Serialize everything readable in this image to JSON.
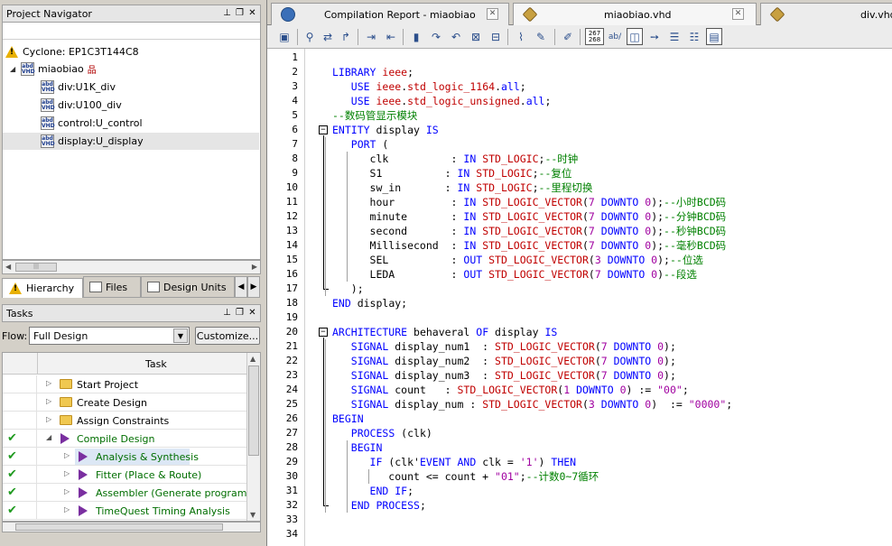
{
  "project_navigator": {
    "title": "Project Navigator",
    "device": "Cyclone: EP1C3T144C8",
    "top_entity": "miaobiao",
    "entities": [
      "div:U1K_div",
      "div:U100_div",
      "control:U_control",
      "display:U_display"
    ],
    "tabs": [
      "Hierarchy",
      "Files",
      "Design Units"
    ]
  },
  "tasks": {
    "title": "Tasks",
    "flow_label": "Flow:",
    "flow_value": "Full Design",
    "customize_label": "Customize...",
    "column_task": "Task",
    "rows": [
      {
        "label": "Start Project",
        "done": false
      },
      {
        "label": "Create Design",
        "done": false
      },
      {
        "label": "Assign Constraints",
        "done": false
      },
      {
        "label": "Compile Design",
        "done": true
      },
      {
        "label": "Analysis & Synthesis",
        "done": true
      },
      {
        "label": "Fitter (Place & Route)",
        "done": true
      },
      {
        "label": "Assembler (Generate programming",
        "done": true
      },
      {
        "label": "TimeQuest Timing Analysis",
        "done": true
      }
    ]
  },
  "editor": {
    "tabs": [
      {
        "label": "Compilation Report - miaobiao",
        "icon": "report-icon"
      },
      {
        "label": "miaobiao.vhd",
        "icon": "vhd-file-icon"
      },
      {
        "label": "div.vhd",
        "icon": "vhd-file-icon"
      }
    ],
    "toolbar": {
      "line_counter_top": "267",
      "line_counter_bottom": "268",
      "abc_label": "ab/"
    },
    "lines": [
      [],
      [
        [
          "k",
          "LIBRARY "
        ],
        [
          "t",
          "ieee"
        ],
        [
          "n",
          ";"
        ]
      ],
      [
        [
          "n",
          "   "
        ],
        [
          "k",
          "USE "
        ],
        [
          "t",
          "ieee"
        ],
        [
          "n",
          "."
        ],
        [
          "t",
          "std_logic_1164"
        ],
        [
          "n",
          "."
        ],
        [
          "k",
          "all"
        ],
        [
          "n",
          ";"
        ]
      ],
      [
        [
          "n",
          "   "
        ],
        [
          "k",
          "USE "
        ],
        [
          "t",
          "ieee"
        ],
        [
          "n",
          "."
        ],
        [
          "t",
          "std_logic_unsigned"
        ],
        [
          "n",
          "."
        ],
        [
          "k",
          "all"
        ],
        [
          "n",
          ";"
        ]
      ],
      [
        [
          "c",
          "--数码管显示模块"
        ]
      ],
      [
        [
          "k",
          "ENTITY "
        ],
        [
          "n",
          "display "
        ],
        [
          "k",
          "IS"
        ]
      ],
      [
        [
          "n",
          "   "
        ],
        [
          "k",
          "PORT "
        ],
        [
          "n",
          "("
        ]
      ],
      [
        [
          "n",
          "      clk          : "
        ],
        [
          "k",
          "IN "
        ],
        [
          "t",
          "STD_LOGIC"
        ],
        [
          "n",
          ";"
        ],
        [
          "c",
          "--时钟"
        ]
      ],
      [
        [
          "n",
          "      S1          : "
        ],
        [
          "k",
          "IN "
        ],
        [
          "t",
          "STD_LOGIC"
        ],
        [
          "n",
          ";"
        ],
        [
          "c",
          "--复位"
        ]
      ],
      [
        [
          "n",
          "      sw_in       : "
        ],
        [
          "k",
          "IN "
        ],
        [
          "t",
          "STD_LOGIC"
        ],
        [
          "n",
          ";"
        ],
        [
          "c",
          "--里程切换"
        ]
      ],
      [
        [
          "n",
          "      hour         : "
        ],
        [
          "k",
          "IN "
        ],
        [
          "t",
          "STD_LOGIC_VECTOR"
        ],
        [
          "n",
          "("
        ],
        [
          "s",
          "7"
        ],
        [
          "n",
          " "
        ],
        [
          "k",
          "DOWNTO "
        ],
        [
          "s",
          "0"
        ],
        [
          "n",
          ");"
        ],
        [
          "c",
          "--小时BCD码"
        ]
      ],
      [
        [
          "n",
          "      minute       : "
        ],
        [
          "k",
          "IN "
        ],
        [
          "t",
          "STD_LOGIC_VECTOR"
        ],
        [
          "n",
          "("
        ],
        [
          "s",
          "7"
        ],
        [
          "n",
          " "
        ],
        [
          "k",
          "DOWNTO "
        ],
        [
          "s",
          "0"
        ],
        [
          "n",
          ");"
        ],
        [
          "c",
          "--分钟BCD码"
        ]
      ],
      [
        [
          "n",
          "      second       : "
        ],
        [
          "k",
          "IN "
        ],
        [
          "t",
          "STD_LOGIC_VECTOR"
        ],
        [
          "n",
          "("
        ],
        [
          "s",
          "7"
        ],
        [
          "n",
          " "
        ],
        [
          "k",
          "DOWNTO "
        ],
        [
          "s",
          "0"
        ],
        [
          "n",
          ");"
        ],
        [
          "c",
          "--秒钟BCD码"
        ]
      ],
      [
        [
          "n",
          "      Millisecond  : "
        ],
        [
          "k",
          "IN "
        ],
        [
          "t",
          "STD_LOGIC_VECTOR"
        ],
        [
          "n",
          "("
        ],
        [
          "s",
          "7"
        ],
        [
          "n",
          " "
        ],
        [
          "k",
          "DOWNTO "
        ],
        [
          "s",
          "0"
        ],
        [
          "n",
          ");"
        ],
        [
          "c",
          "--毫秒BCD码"
        ]
      ],
      [
        [
          "n",
          "      SEL          : "
        ],
        [
          "k",
          "OUT "
        ],
        [
          "t",
          "STD_LOGIC_VECTOR"
        ],
        [
          "n",
          "("
        ],
        [
          "s",
          "3"
        ],
        [
          "n",
          " "
        ],
        [
          "k",
          "DOWNTO "
        ],
        [
          "s",
          "0"
        ],
        [
          "n",
          ");"
        ],
        [
          "c",
          "--位选"
        ]
      ],
      [
        [
          "n",
          "      LEDA         : "
        ],
        [
          "k",
          "OUT "
        ],
        [
          "t",
          "STD_LOGIC_VECTOR"
        ],
        [
          "n",
          "("
        ],
        [
          "s",
          "7"
        ],
        [
          "n",
          " "
        ],
        [
          "k",
          "DOWNTO "
        ],
        [
          "s",
          "0"
        ],
        [
          "n",
          ")"
        ],
        [
          "c",
          "--段选"
        ]
      ],
      [
        [
          "n",
          "   );"
        ]
      ],
      [
        [
          "k",
          "END "
        ],
        [
          "n",
          "display;"
        ]
      ],
      [],
      [
        [
          "k",
          "ARCHITECTURE "
        ],
        [
          "n",
          "behaveral "
        ],
        [
          "k",
          "OF "
        ],
        [
          "n",
          "display "
        ],
        [
          "k",
          "IS"
        ]
      ],
      [
        [
          "n",
          "   "
        ],
        [
          "k",
          "SIGNAL "
        ],
        [
          "n",
          "display_num1  : "
        ],
        [
          "t",
          "STD_LOGIC_VECTOR"
        ],
        [
          "n",
          "("
        ],
        [
          "s",
          "7"
        ],
        [
          "n",
          " "
        ],
        [
          "k",
          "DOWNTO "
        ],
        [
          "s",
          "0"
        ],
        [
          "n",
          ");"
        ]
      ],
      [
        [
          "n",
          "   "
        ],
        [
          "k",
          "SIGNAL "
        ],
        [
          "n",
          "display_num2  : "
        ],
        [
          "t",
          "STD_LOGIC_VECTOR"
        ],
        [
          "n",
          "("
        ],
        [
          "s",
          "7"
        ],
        [
          "n",
          " "
        ],
        [
          "k",
          "DOWNTO "
        ],
        [
          "s",
          "0"
        ],
        [
          "n",
          ");"
        ]
      ],
      [
        [
          "n",
          "   "
        ],
        [
          "k",
          "SIGNAL "
        ],
        [
          "n",
          "display_num3  : "
        ],
        [
          "t",
          "STD_LOGIC_VECTOR"
        ],
        [
          "n",
          "("
        ],
        [
          "s",
          "7"
        ],
        [
          "n",
          " "
        ],
        [
          "k",
          "DOWNTO "
        ],
        [
          "s",
          "0"
        ],
        [
          "n",
          ");"
        ]
      ],
      [
        [
          "n",
          "   "
        ],
        [
          "k",
          "SIGNAL "
        ],
        [
          "n",
          "count   : "
        ],
        [
          "t",
          "STD_LOGIC_VECTOR"
        ],
        [
          "n",
          "("
        ],
        [
          "s",
          "1"
        ],
        [
          "n",
          " "
        ],
        [
          "k",
          "DOWNTO "
        ],
        [
          "s",
          "0"
        ],
        [
          "n",
          ") := "
        ],
        [
          "s",
          "\"00\""
        ],
        [
          "n",
          ";"
        ]
      ],
      [
        [
          "n",
          "   "
        ],
        [
          "k",
          "SIGNAL "
        ],
        [
          "n",
          "display_num : "
        ],
        [
          "t",
          "STD_LOGIC_VECTOR"
        ],
        [
          "n",
          "("
        ],
        [
          "s",
          "3"
        ],
        [
          "n",
          " "
        ],
        [
          "k",
          "DOWNTO "
        ],
        [
          "s",
          "0"
        ],
        [
          "n",
          ")  := "
        ],
        [
          "s",
          "\"0000\""
        ],
        [
          "n",
          ";"
        ]
      ],
      [
        [
          "k",
          "BEGIN"
        ]
      ],
      [
        [
          "n",
          "   "
        ],
        [
          "k",
          "PROCESS "
        ],
        [
          "n",
          "(clk)"
        ]
      ],
      [
        [
          "n",
          "   "
        ],
        [
          "k",
          "BEGIN"
        ]
      ],
      [
        [
          "n",
          "      "
        ],
        [
          "k",
          "IF "
        ],
        [
          "n",
          "(clk'"
        ],
        [
          "k",
          "EVENT "
        ],
        [
          "k",
          "AND "
        ],
        [
          "n",
          "clk = "
        ],
        [
          "s",
          "'1'"
        ],
        [
          "n",
          ") "
        ],
        [
          "k",
          "THEN"
        ]
      ],
      [
        [
          "n",
          "         count <= count + "
        ],
        [
          "s",
          "\"01\""
        ],
        [
          "n",
          ";"
        ],
        [
          "c",
          "--计数0~7循环"
        ]
      ],
      [
        [
          "n",
          "      "
        ],
        [
          "k",
          "END IF"
        ],
        [
          "n",
          ";"
        ]
      ],
      [
        [
          "n",
          "   "
        ],
        [
          "k",
          "END PROCESS"
        ],
        [
          "n",
          ";"
        ]
      ],
      [],
      []
    ]
  }
}
